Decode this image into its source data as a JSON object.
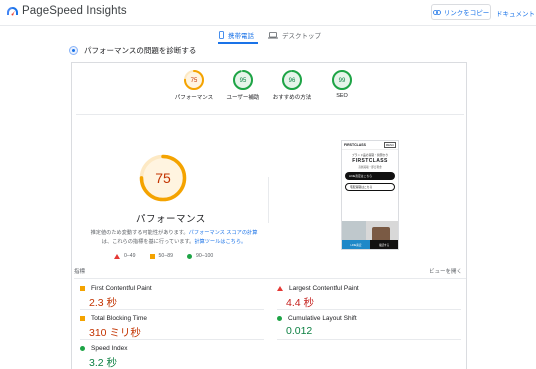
{
  "header": {
    "app_title": "PageSpeed Insights",
    "copy_link_label": "リンクをコピー",
    "docs_label": "ドキュメント"
  },
  "tabs": [
    {
      "label": "携帯電話",
      "active": true
    },
    {
      "label": "デスクトップ",
      "active": false
    }
  ],
  "diagnose_label": "パフォーマンスの問題を診断する",
  "category_scores": [
    {
      "score": "75",
      "label": "パフォーマンス",
      "color": "#f4a300",
      "fraction": 0.75
    },
    {
      "score": "95",
      "label": "ユーザー補助",
      "color": "#1ea446",
      "fraction": 0.95
    },
    {
      "score": "96",
      "label": "おすすめの方法",
      "color": "#1ea446",
      "fraction": 0.96
    },
    {
      "score": "99",
      "label": "SEO",
      "color": "#1ea446",
      "fraction": 0.99
    }
  ],
  "main_score": {
    "score": "75",
    "title": "パフォーマンス",
    "fraction": 0.75,
    "color": "#f4a300"
  },
  "description": {
    "text1": "推定値のため変動する可能性があります。",
    "link1": "パフォーマンス スコアの計算",
    "text2": "は、これらの指標を基に行っています。",
    "link2": "計算ツールはこちら。"
  },
  "legend": [
    {
      "shape": "triangle",
      "range": "0–49"
    },
    {
      "shape": "square",
      "range": "50–89"
    },
    {
      "shape": "circle",
      "range": "90–100"
    }
  ],
  "preview": {
    "brand_header": "FIRSTCLASS",
    "menu_btn": "MENU",
    "subtitle": "ブランド品の買取・質預かり",
    "brand": "FIRSTCLASS",
    "small": "高価買取・即日現金",
    "pill1": "LINE査定はこちら",
    "pill2": "宅配買取はこちら",
    "cta1": "LINE査定",
    "cta2": "電話する"
  },
  "metrics_section": {
    "label": "指標",
    "toggle": "ビューを開く"
  },
  "metrics": [
    {
      "name": "First Contentful Paint",
      "value": "2.3 秒",
      "status": "average"
    },
    {
      "name": "Largest Contentful Paint",
      "value": "4.4 秒",
      "status": "fail"
    },
    {
      "name": "Total Blocking Time",
      "value": "310 ミリ秒",
      "status": "average"
    },
    {
      "name": "Cumulative Layout Shift",
      "value": "0.012",
      "status": "pass"
    },
    {
      "name": "Speed Index",
      "value": "3.2 秒",
      "status": "pass"
    }
  ],
  "colors": {
    "accent": "#1a73e8",
    "average": "#f4a300",
    "pass": "#1ea446",
    "fail": "#e53935"
  }
}
